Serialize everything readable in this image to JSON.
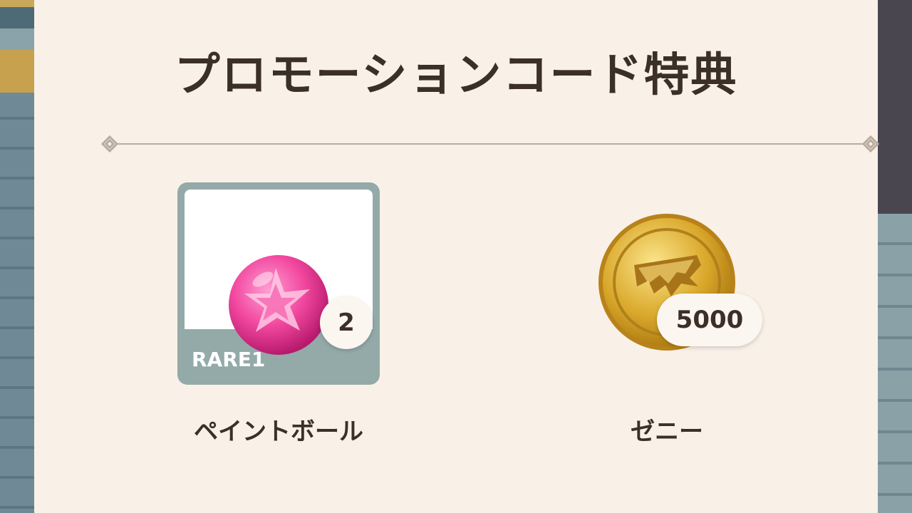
{
  "dialog": {
    "title": "プロモーションコード特典"
  },
  "rewards": [
    {
      "name": "ペイントボール",
      "rarity": "RARE1",
      "count": "2",
      "icon": "pink-paintball-icon"
    },
    {
      "name": "ゼニー",
      "amount": "5000",
      "icon": "gold-zenny-coin-icon"
    }
  ],
  "colors": {
    "panel_bg": "#f9f1e8",
    "title_text": "#3b2f27",
    "card_rare": "#93aaa8",
    "badge_bg": "#fbf7f0"
  }
}
